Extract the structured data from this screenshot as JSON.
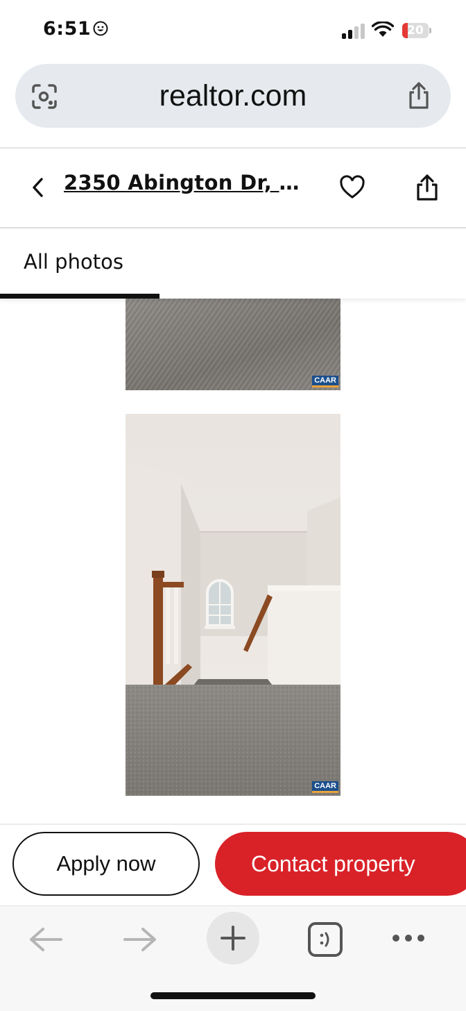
{
  "status_bar": {
    "time": "6:51",
    "battery": "20"
  },
  "browser": {
    "url": "realtor.com"
  },
  "listing": {
    "address": "2350 Abington Dr, C..."
  },
  "tabs": [
    {
      "label": "All photos",
      "active": true
    }
  ],
  "photos": [
    {
      "badge": "CAAR"
    },
    {
      "badge": "CAAR"
    }
  ],
  "actions": {
    "apply_label": "Apply now",
    "contact_label": "Contact property"
  },
  "colors": {
    "accent": "#d92228",
    "url_bar": "#e6eaee",
    "battery": "#e53935"
  },
  "icons": [
    "back-chevron-icon",
    "heart-icon",
    "share-icon",
    "lens-icon",
    "plus-icon",
    "tabs-icon",
    "more-icon",
    "arrow-left-icon",
    "arrow-right-icon"
  ]
}
